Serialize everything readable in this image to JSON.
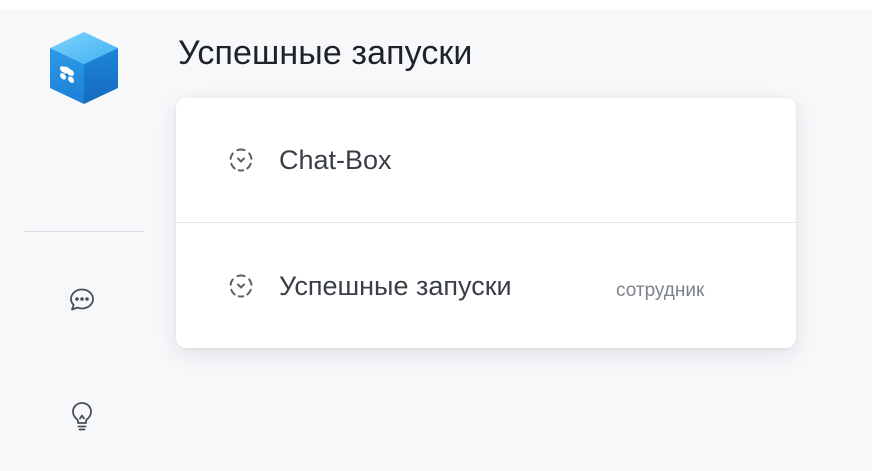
{
  "app": {
    "logo_icon": "cube-logo-icon",
    "brand_color": "#2c9be6"
  },
  "sidebar": {
    "items": [
      {
        "icon": "chat-bubble-icon"
      },
      {
        "icon": "lightbulb-icon"
      }
    ]
  },
  "header": {
    "title": "Успешные запуски"
  },
  "dropdown": {
    "items": [
      {
        "icon": "dashed-circle-icon",
        "label": "Chat-Box",
        "badge": ""
      },
      {
        "icon": "dashed-circle-icon",
        "label": "Успешные запуски",
        "badge": "сотрудник"
      }
    ]
  },
  "colors": {
    "background": "#f7f8fa",
    "card": "#ffffff",
    "text_primary": "#1f2329",
    "text_secondary": "#3a3f47",
    "text_muted": "#7c828c",
    "icon_stroke": "#4a4f57"
  }
}
